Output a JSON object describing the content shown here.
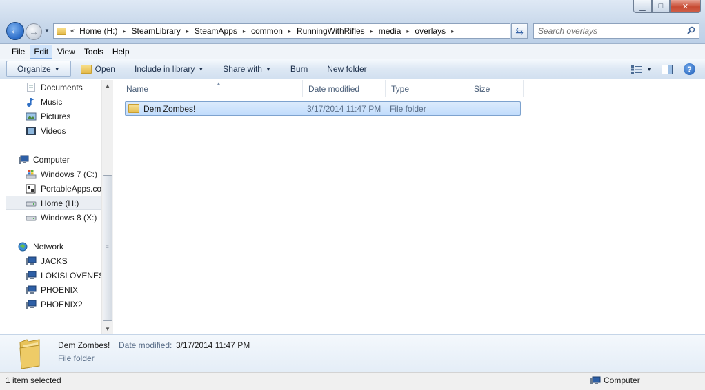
{
  "window": {
    "minimize_glyph": "▁",
    "maximize_glyph": "□",
    "close_glyph": "✕"
  },
  "address_bar": {
    "leading_chevron": "«",
    "crumbs": [
      "Home (H:)",
      "SteamLibrary",
      "SteamApps",
      "common",
      "RunningWithRifles",
      "media",
      "overlays"
    ],
    "separator": "▸"
  },
  "search": {
    "placeholder": "Search overlays"
  },
  "menu": {
    "items": [
      "File",
      "Edit",
      "View",
      "Tools",
      "Help"
    ],
    "active_index": 1
  },
  "toolbar": {
    "organize": "Organize",
    "open": "Open",
    "include_in_library": "Include in library",
    "share_with": "Share with",
    "burn": "Burn",
    "new_folder": "New folder"
  },
  "nav_pane": {
    "items": [
      {
        "label": "Documents",
        "icon": "documents-icon"
      },
      {
        "label": "Music",
        "icon": "music-icon"
      },
      {
        "label": "Pictures",
        "icon": "pictures-icon"
      },
      {
        "label": "Videos",
        "icon": "videos-icon"
      },
      {
        "label": "Computer",
        "icon": "computer-icon"
      },
      {
        "label": "Windows 7 (C:)",
        "icon": "windows-drive-icon"
      },
      {
        "label": "PortableApps.com",
        "icon": "portableapps-icon"
      },
      {
        "label": "Home (H:)",
        "icon": "drive-icon",
        "selected": true
      },
      {
        "label": "Windows 8 (X:)",
        "icon": "drive-icon"
      },
      {
        "label": "Network",
        "icon": "network-icon"
      },
      {
        "label": "JACKS",
        "icon": "network-computer-icon"
      },
      {
        "label": "LOKISLOVENEST",
        "icon": "network-computer-icon"
      },
      {
        "label": "PHOENIX",
        "icon": "network-computer-icon"
      },
      {
        "label": "PHOENIX2",
        "icon": "network-computer-icon"
      }
    ]
  },
  "columns": {
    "name": "Name",
    "date_modified": "Date modified",
    "type": "Type",
    "size": "Size"
  },
  "files": [
    {
      "name": "Dem Zombes!",
      "date_modified": "3/17/2014 11:47 PM",
      "type": "File folder",
      "size": ""
    }
  ],
  "details": {
    "name": "Dem Zombes!",
    "date_label": "Date modified:",
    "date_value": "3/17/2014 11:47 PM",
    "type": "File folder"
  },
  "status": {
    "selection": "1 item selected",
    "location": "Computer"
  }
}
